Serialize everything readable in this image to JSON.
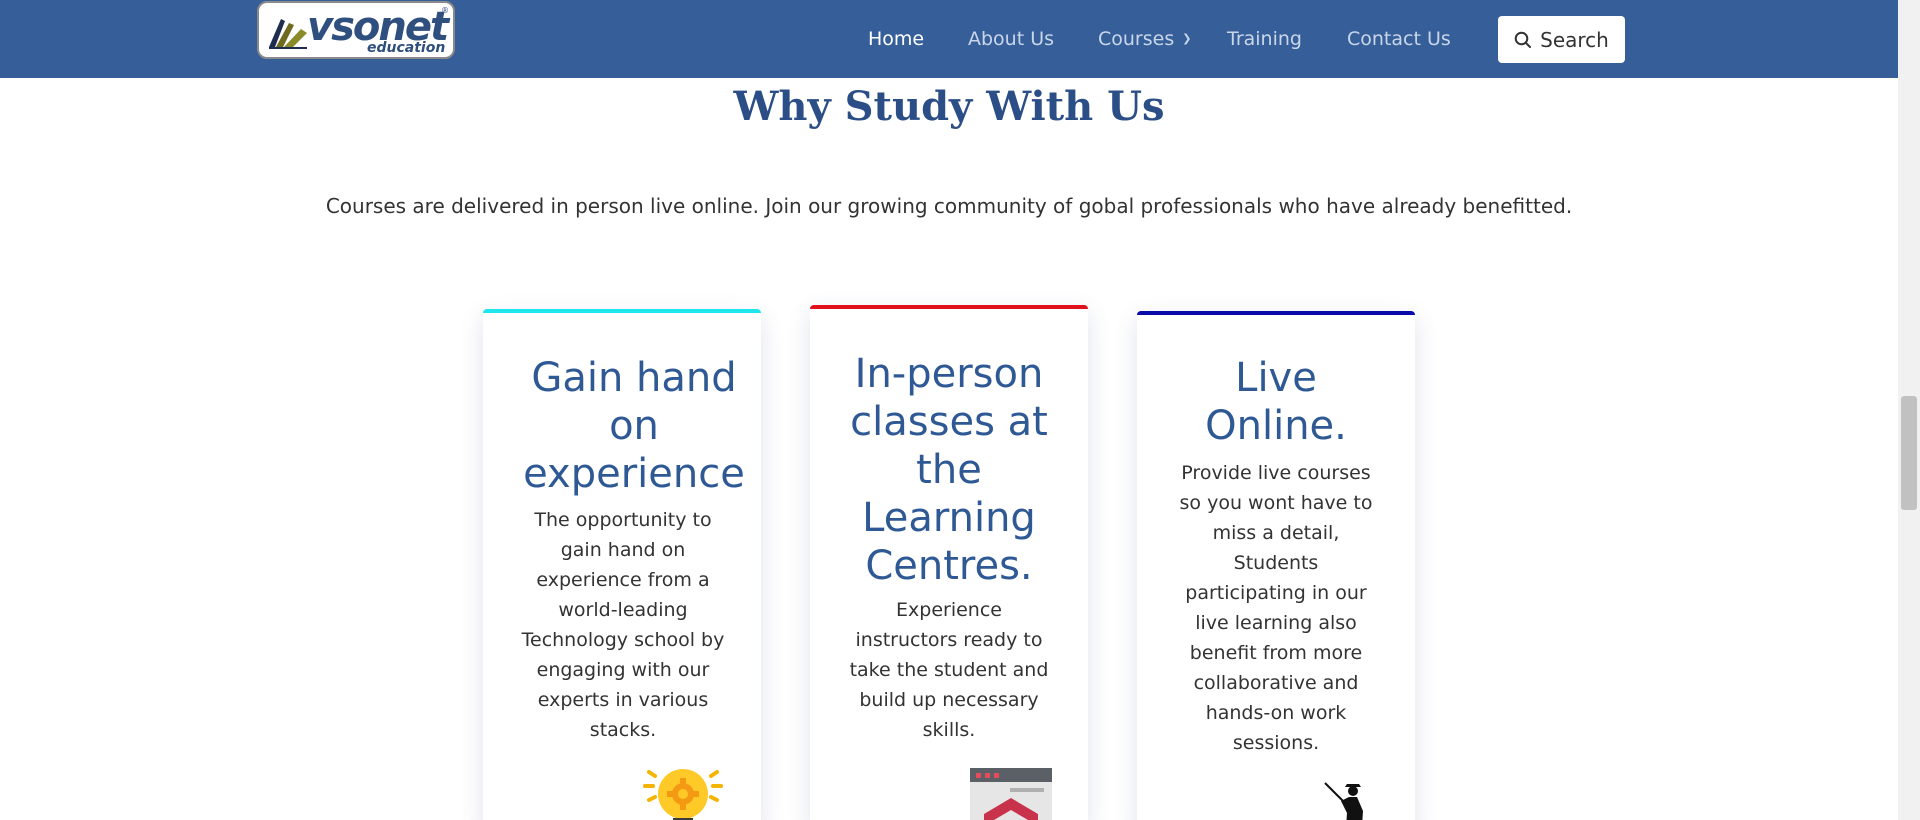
{
  "header": {
    "logo": {
      "word": "vsonet",
      "sub": "education",
      "reg": "®"
    },
    "nav": [
      {
        "label": "Home"
      },
      {
        "label": "About Us"
      },
      {
        "label": "Courses"
      },
      {
        "label": "Training"
      },
      {
        "label": "Contact Us"
      }
    ],
    "search_label": "Search"
  },
  "section": {
    "title": "Why Study With Us",
    "subtitle": "Courses are delivered in person live online. Join our growing community of gobal professionals who have already benefitted."
  },
  "cards": [
    {
      "title": "Gain hand on experience",
      "text": "The opportunity to gain hand on experience from a world-leading Technology school by engaging with our experts in various stacks.",
      "accent": "#1ee6ec",
      "icon": "lightbulb-gear-icon"
    },
    {
      "title": "In-person classes at the Learning Centres.",
      "text": "Experience instructors ready to take the student and build up necessary skills.",
      "accent": "#e0101d",
      "icon": "building-icon"
    },
    {
      "title": "Live Online.",
      "text": "Provide live courses so you wont have to miss a detail, Students participating in our live learning also benefit from more collaborative and hands-on work sessions.",
      "accent": "#0a0aa8",
      "icon": "teacher-pointer-icon"
    }
  ],
  "colors": {
    "header_bg": "#365f99",
    "title": "#2b4e86",
    "card_title": "#2e5994"
  }
}
